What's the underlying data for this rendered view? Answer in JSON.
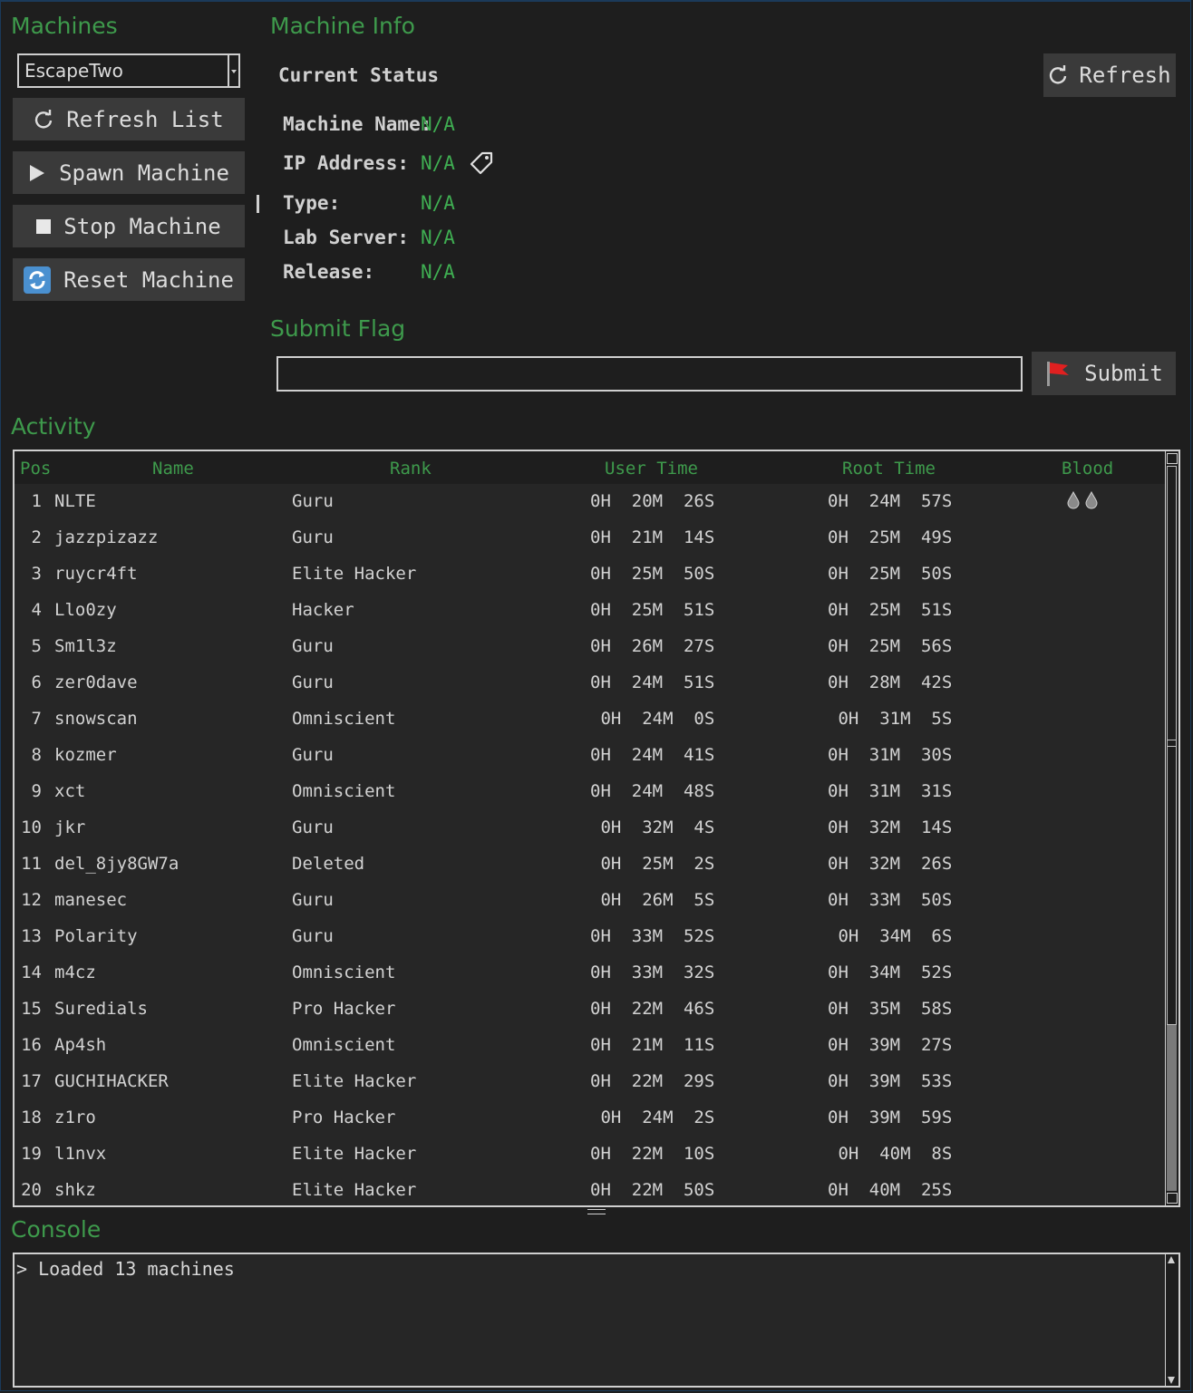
{
  "machines": {
    "title": "Machines",
    "selected": "EscapeTwo",
    "buttons": {
      "refresh_list": "Refresh List",
      "spawn": "Spawn Machine",
      "stop": "Stop Machine",
      "reset": "Reset Machine"
    }
  },
  "info": {
    "title": "Machine Info",
    "current_status": "Current Status",
    "refresh": "Refresh",
    "labels": {
      "name": "Machine Name:",
      "ip": "IP Address:",
      "type": "Type:",
      "lab": "Lab Server:",
      "release": "Release:"
    },
    "values": {
      "name": "N/A",
      "ip": "N/A",
      "type": "N/A",
      "lab": "N/A",
      "release": "N/A"
    }
  },
  "flag": {
    "title": "Submit Flag",
    "value": "",
    "submit": "Submit"
  },
  "activity": {
    "title": "Activity",
    "headers": {
      "pos": "Pos",
      "name": "Name",
      "rank": "Rank",
      "user_time": "User Time",
      "root_time": "Root Time",
      "blood": "Blood"
    },
    "rows": [
      {
        "pos": "1",
        "name": "NLTE",
        "rank": "Guru",
        "user": "0H  20M  26S",
        "root": "0H  24M  57S",
        "blood": true
      },
      {
        "pos": "2",
        "name": "jazzpizazz",
        "rank": "Guru",
        "user": "0H  21M  14S",
        "root": "0H  25M  49S",
        "blood": false
      },
      {
        "pos": "3",
        "name": "ruycr4ft",
        "rank": "Elite Hacker",
        "user": "0H  25M  50S",
        "root": "0H  25M  50S",
        "blood": false
      },
      {
        "pos": "4",
        "name": "Llo0zy",
        "rank": "Hacker",
        "user": "0H  25M  51S",
        "root": "0H  25M  51S",
        "blood": false
      },
      {
        "pos": "5",
        "name": "Sm1l3z",
        "rank": "Guru",
        "user": "0H  26M  27S",
        "root": "0H  25M  56S",
        "blood": false
      },
      {
        "pos": "6",
        "name": "zer0dave",
        "rank": "Guru",
        "user": "0H  24M  51S",
        "root": "0H  28M  42S",
        "blood": false
      },
      {
        "pos": "7",
        "name": "snowscan",
        "rank": "Omniscient",
        "user": " 0H  24M  0S",
        "root": " 0H  31M  5S",
        "blood": false
      },
      {
        "pos": "8",
        "name": "kozmer",
        "rank": "Guru",
        "user": "0H  24M  41S",
        "root": "0H  31M  30S",
        "blood": false
      },
      {
        "pos": "9",
        "name": "xct",
        "rank": "Omniscient",
        "user": "0H  24M  48S",
        "root": "0H  31M  31S",
        "blood": false
      },
      {
        "pos": "10",
        "name": "jkr",
        "rank": "Guru",
        "user": " 0H  32M  4S",
        "root": "0H  32M  14S",
        "blood": false
      },
      {
        "pos": "11",
        "name": "del_8jy8GW7a",
        "rank": "Deleted",
        "user": " 0H  25M  2S",
        "root": "0H  32M  26S",
        "blood": false
      },
      {
        "pos": "12",
        "name": "manesec",
        "rank": "Guru",
        "user": " 0H  26M  5S",
        "root": "0H  33M  50S",
        "blood": false
      },
      {
        "pos": "13",
        "name": "Polarity",
        "rank": "Guru",
        "user": "0H  33M  52S",
        "root": " 0H  34M  6S",
        "blood": false
      },
      {
        "pos": "14",
        "name": "m4cz",
        "rank": "Omniscient",
        "user": "0H  33M  32S",
        "root": "0H  34M  52S",
        "blood": false
      },
      {
        "pos": "15",
        "name": "Suredials",
        "rank": "Pro Hacker",
        "user": "0H  22M  46S",
        "root": "0H  35M  58S",
        "blood": false
      },
      {
        "pos": "16",
        "name": "Ap4sh",
        "rank": "Omniscient",
        "user": "0H  21M  11S",
        "root": "0H  39M  27S",
        "blood": false
      },
      {
        "pos": "17",
        "name": "GUCHIHACKER",
        "rank": "Elite Hacker",
        "user": "0H  22M  29S",
        "root": "0H  39M  53S",
        "blood": false
      },
      {
        "pos": "18",
        "name": "z1ro",
        "rank": "Pro Hacker",
        "user": " 0H  24M  2S",
        "root": "0H  39M  59S",
        "blood": false
      },
      {
        "pos": "19",
        "name": "l1nvx",
        "rank": "Elite Hacker",
        "user": "0H  22M  10S",
        "root": " 0H  40M  8S",
        "blood": false
      },
      {
        "pos": "20",
        "name": "shkz",
        "rank": "Elite Hacker",
        "user": "0H  22M  50S",
        "root": "0H  40M  25S",
        "blood": false
      }
    ]
  },
  "console": {
    "title": "Console",
    "lines": [
      "> Loaded 13 machines"
    ]
  },
  "colors": {
    "accent_green": "#3e9a4c",
    "value_green": "#3fae52",
    "background": "#1e1e1e",
    "button": "#3a3a3a"
  }
}
